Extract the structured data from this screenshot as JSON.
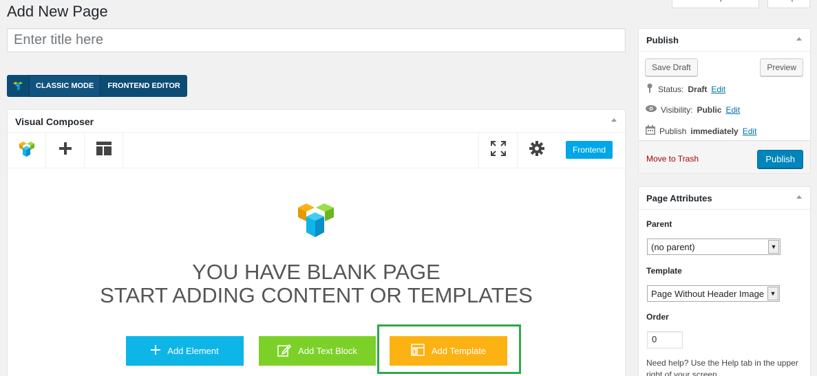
{
  "header": {
    "title": "Add New Page",
    "screen_options": "Screen Options",
    "help": "Help"
  },
  "title_input": {
    "placeholder": "Enter title here"
  },
  "mode_switch": {
    "classic": "CLASSIC MODE",
    "frontend": "FRONTEND EDITOR"
  },
  "vc": {
    "title": "Visual Composer",
    "frontend_btn": "Frontend",
    "blank_line1": "YOU HAVE BLANK PAGE",
    "blank_line2": "START ADDING CONTENT OR TEMPLATES",
    "add_element": "Add Element",
    "add_text_block": "Add Text Block",
    "add_template": "Add Template"
  },
  "publish": {
    "title": "Publish",
    "save_draft": "Save Draft",
    "preview": "Preview",
    "status_label": "Status:",
    "status_value": "Draft",
    "visibility_label": "Visibility:",
    "visibility_value": "Public",
    "schedule_label": "Publish",
    "schedule_value": "immediately",
    "edit": "Edit",
    "move_to_trash": "Move to Trash",
    "publish_btn": "Publish"
  },
  "attributes": {
    "title": "Page Attributes",
    "parent_label": "Parent",
    "parent_value": "(no parent)",
    "template_label": "Template",
    "template_value": "Page Without Header Image",
    "order_label": "Order",
    "order_value": "0",
    "help_text": "Need help? Use the Help tab in the upper right of your screen."
  },
  "colors": {
    "add_element": "#0db6e7",
    "add_text_block": "#7cd129",
    "add_template": "#fcb213",
    "highlight": "#2fa84a",
    "publish": "#0085ba"
  }
}
